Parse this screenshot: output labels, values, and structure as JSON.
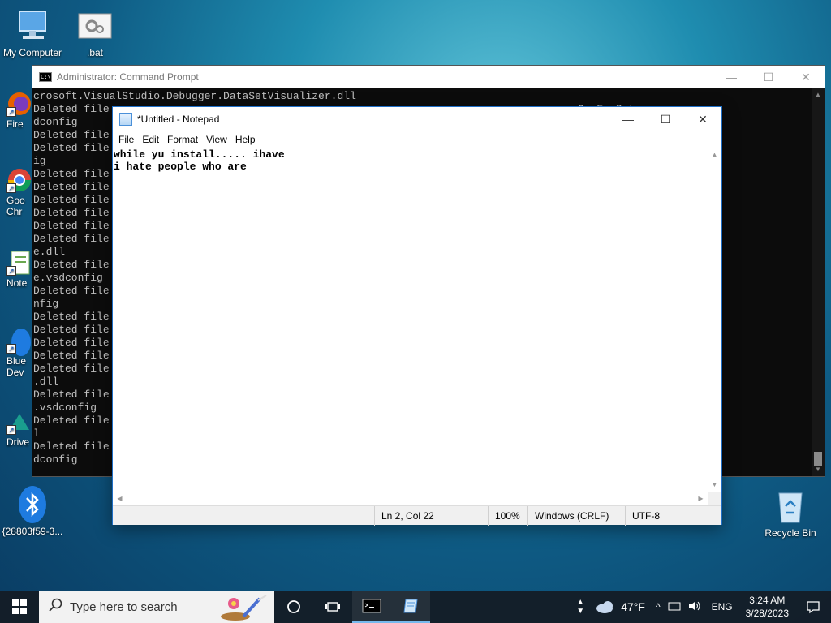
{
  "desktop": {
    "icons": {
      "my_computer": "My Computer",
      "bat": ".bat",
      "recycle_bin": "Recycle Bin",
      "bluetooth_guid": "{28803f59-3..."
    },
    "partial_labels": {
      "firefox": "Fire",
      "chrome_1": "Goo",
      "chrome_2": "Chr",
      "notepad": "Note",
      "bluetooth_1": "Blue",
      "bluetooth_2": "Dev",
      "drive": "Drive"
    }
  },
  "cmd": {
    "title": "Administrator: Command Prompt",
    "lines": [
      "crosoft.VisualStudio.Debugger.DataSetVisualizer.dll",
      "Deleted file                                                                          GpuEnvSetup.vs",
      "dconfig",
      "Deleted file                                                                          HlslEE.dll",
      "Deleted file                                                                          HlslEE.vsdconf",
      "ig",
      "Deleted file                                                                          jsee.dll",
      "Deleted file                                                                          MCppEE.dll",
      "Deleted file                                                                          MCppEE.vsdconf",
      "Deleted file                                                                          cpde.dll",
      "Deleted file                                                                          cppdebug.dll",
      "Deleted file                                                                          cppdebug.remot",
      "e.dll",
      "Deleted file                                                                          cppdebug.remot",
      "e.vsdconfig",
      "Deleted file                                                                          cppdebug.vsdco",
      "nfig",
      "Deleted file                                                                          cscompee.dll",
      "Deleted file                                                                          dbgshim.dll",
      "Deleted file                                                                          ecbuild.dll",
      "Deleted file                                                                          encmgr.dll",
      "Deleted file                                                                          GpuDebugEngine",
      ".dll",
      "Deleted file                                                                          GpuDebugEngine",
      ".vsdconfig",
      "Deleted file                                                                          GpuEnvSetup.dl",
      "l",
      "Deleted file                                                                          GpuEnvSetup.vs",
      "dconfig"
    ]
  },
  "notepad": {
    "title": "*Untitled - Notepad",
    "menu": [
      "File",
      "Edit",
      "Format",
      "View",
      "Help"
    ],
    "content": "while yu install..... ihave\ni hate people who are",
    "status": {
      "position": "Ln 2, Col 22",
      "zoom": "100%",
      "line_ending": "Windows (CRLF)",
      "encoding": "UTF-8"
    }
  },
  "taskbar": {
    "search_placeholder": "Type here to search",
    "weather": "47°F",
    "language": "ENG",
    "time": "3:24 AM",
    "date": "3/28/2023"
  },
  "colors": {
    "taskbar_bg": "#141c26",
    "console_bg": "#0c0c0c",
    "console_text": "#c0c0c0",
    "accent": "#76b9ed"
  }
}
